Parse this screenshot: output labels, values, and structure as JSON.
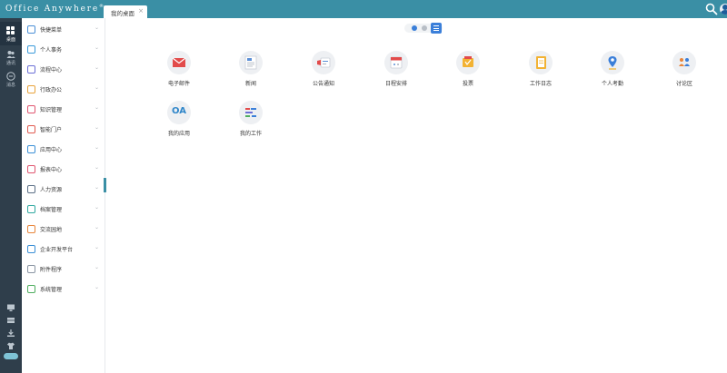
{
  "header": {
    "brand": "Office Anywhere",
    "brand_mark": "®",
    "tab_label": "我的桌面",
    "tab_close": "×",
    "brand_color": "#3a8fa5"
  },
  "rail": {
    "items": [
      {
        "label": "桌面",
        "icon": "grid-icon",
        "active": true
      },
      {
        "label": "通讯",
        "icon": "contacts-icon",
        "active": false
      },
      {
        "label": "消息",
        "icon": "message-icon",
        "active": false
      }
    ],
    "bottom_icons": [
      "monitor-icon",
      "inbox-icon",
      "download-icon",
      "shirt-icon"
    ]
  },
  "sidebar": {
    "items": [
      {
        "label": "快捷菜单",
        "icon": "quick-menu-icon",
        "color": "#4a8fd6"
      },
      {
        "label": "个人事务",
        "icon": "personal-affairs-icon",
        "color": "#3a9ad9"
      },
      {
        "label": "流程中心",
        "icon": "workflow-icon",
        "color": "#6b6fd6"
      },
      {
        "label": "行政办公",
        "icon": "admin-office-icon",
        "color": "#e8a23a"
      },
      {
        "label": "知识管理",
        "icon": "knowledge-icon",
        "color": "#e0556f"
      },
      {
        "label": "智能门户",
        "icon": "portal-icon",
        "color": "#e05a4f"
      },
      {
        "label": "应用中心",
        "icon": "app-center-icon",
        "color": "#3a8fd6"
      },
      {
        "label": "报表中心",
        "icon": "report-icon",
        "color": "#e0556f"
      },
      {
        "label": "人力资源",
        "icon": "hr-icon",
        "color": "#5b6f86"
      },
      {
        "label": "档案管理",
        "icon": "archive-icon",
        "color": "#2fa8a0"
      },
      {
        "label": "交流园地",
        "icon": "community-icon",
        "color": "#e8853a"
      },
      {
        "label": "企业开发平台",
        "icon": "dev-platform-icon",
        "color": "#3a8fd6"
      },
      {
        "label": "附件程序",
        "icon": "attachment-icon",
        "color": "#8a95a3"
      },
      {
        "label": "系统管理",
        "icon": "system-icon",
        "color": "#4fae5f"
      }
    ],
    "chevron": "⌄"
  },
  "main": {
    "apps": [
      {
        "label": "电子邮件",
        "icon": "email-icon"
      },
      {
        "label": "新闻",
        "icon": "news-icon"
      },
      {
        "label": "公告通知",
        "icon": "notice-icon"
      },
      {
        "label": "日程安排",
        "icon": "calendar-icon"
      },
      {
        "label": "投票",
        "icon": "vote-icon"
      },
      {
        "label": "工作日志",
        "icon": "worklog-icon"
      },
      {
        "label": "个人考勤",
        "icon": "attendance-icon"
      },
      {
        "label": "讨论区",
        "icon": "forum-icon"
      },
      {
        "label": "我的应用",
        "icon": "oa-icon",
        "text": "OA"
      },
      {
        "label": "我的工作",
        "icon": "my-work-icon"
      }
    ]
  }
}
